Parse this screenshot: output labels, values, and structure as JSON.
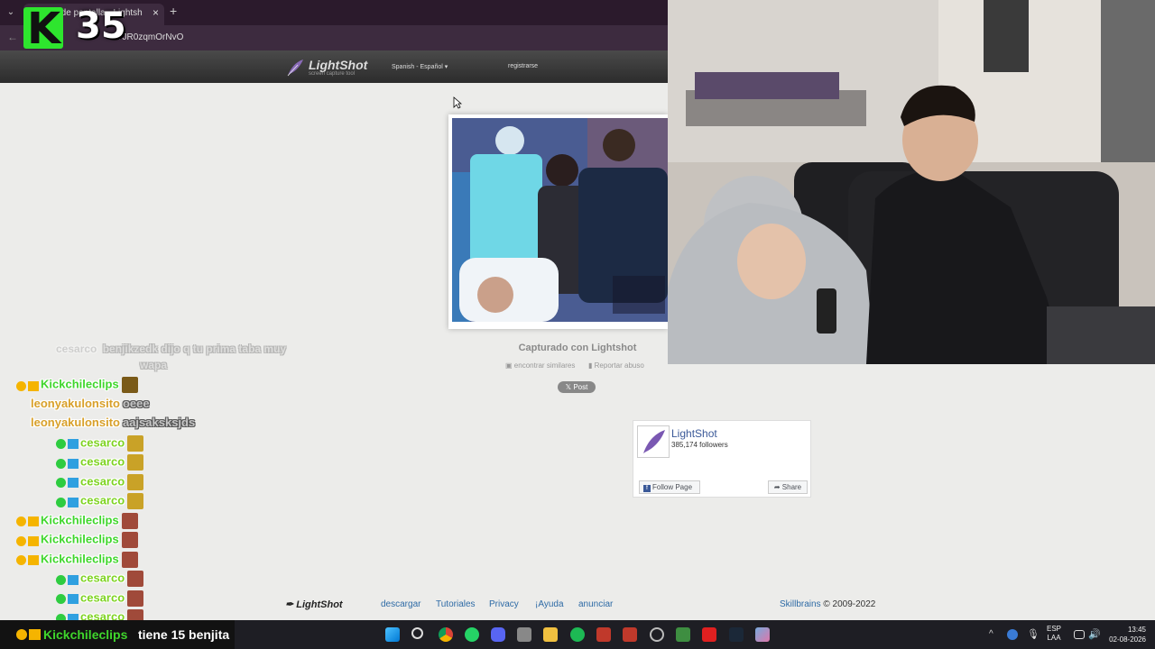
{
  "browser": {
    "tab_title": "ra de pantalla - Lightsh",
    "address": "7JR0zqmOrNvO",
    "new_tab": "+",
    "close_tab": "×"
  },
  "overlay": {
    "kick_letter": "K",
    "viewer_count": "35"
  },
  "header": {
    "logo_name": "LightShot",
    "logo_tagline": "screen capture tool",
    "language": "Spanish - Español",
    "register": "registrarse"
  },
  "screenshot": {
    "caption": "Capturado con Lightshot",
    "find_similar": "encontrar similares",
    "report_abuse": "Reportar abuso",
    "post_button": "Post"
  },
  "facebook": {
    "page_name": "LightShot",
    "followers": "385,174 followers",
    "follow_label": "Follow Page",
    "share_label": "Share"
  },
  "footer": {
    "logo": "LightShot",
    "links": [
      "descargar",
      "Tutoriales",
      "Privacy",
      "¡Ayuda",
      "anunciar"
    ],
    "brand": "Skillbrains",
    "copyright": "© 2009-2022"
  },
  "chat": {
    "faded_line": {
      "user": "cesarco",
      "message": "benjikzedk dijo q tu prima taba muy",
      "message2": "wapa"
    },
    "lines": [
      {
        "user": "Kickchileclips",
        "color": "#3fd62c",
        "message": "",
        "emote_color": "#7a5a18",
        "badge": "gift"
      },
      {
        "user": "leonyakulonsito",
        "color": "#d8a02a",
        "message": "oeee",
        "emote_color": "",
        "badge": "none"
      },
      {
        "user": "leonyakulonsito",
        "color": "#d8a02a",
        "message": "aajsaksksjds",
        "emote_color": "",
        "badge": "none"
      },
      {
        "user": "cesarco",
        "color": "#7ed321",
        "message": "",
        "emote_color": "#c9a227",
        "badge": "check"
      },
      {
        "user": "cesarco",
        "color": "#7ed321",
        "message": "",
        "emote_color": "#c9a227",
        "badge": "check"
      },
      {
        "user": "cesarco",
        "color": "#7ed321",
        "message": "",
        "emote_color": "#c9a227",
        "badge": "check"
      },
      {
        "user": "cesarco",
        "color": "#7ed321",
        "message": "",
        "emote_color": "#c9a227",
        "badge": "check"
      },
      {
        "user": "Kickchileclips",
        "color": "#3fd62c",
        "message": "",
        "emote_color": "#a04a3a",
        "badge": "gift"
      },
      {
        "user": "Kickchileclips",
        "color": "#3fd62c",
        "message": "",
        "emote_color": "#a04a3a",
        "badge": "gift"
      },
      {
        "user": "Kickchileclips",
        "color": "#3fd62c",
        "message": "",
        "emote_color": "#a04a3a",
        "badge": "gift"
      },
      {
        "user": "cesarco",
        "color": "#7ed321",
        "message": "",
        "emote_color": "#a04a3a",
        "badge": "check"
      },
      {
        "user": "cesarco",
        "color": "#7ed321",
        "message": "",
        "emote_color": "#a04a3a",
        "badge": "check"
      },
      {
        "user": "cesarco",
        "color": "#7ed321",
        "message": "",
        "emote_color": "#a04a3a",
        "badge": "check"
      }
    ],
    "bottom_user": "Kickchileclips",
    "bottom_message": "tiene 15 benjita"
  },
  "taskbar": {
    "lang_line1": "ESP",
    "lang_line2": "LAA",
    "time": "13:45",
    "date": "02-08-2026"
  }
}
